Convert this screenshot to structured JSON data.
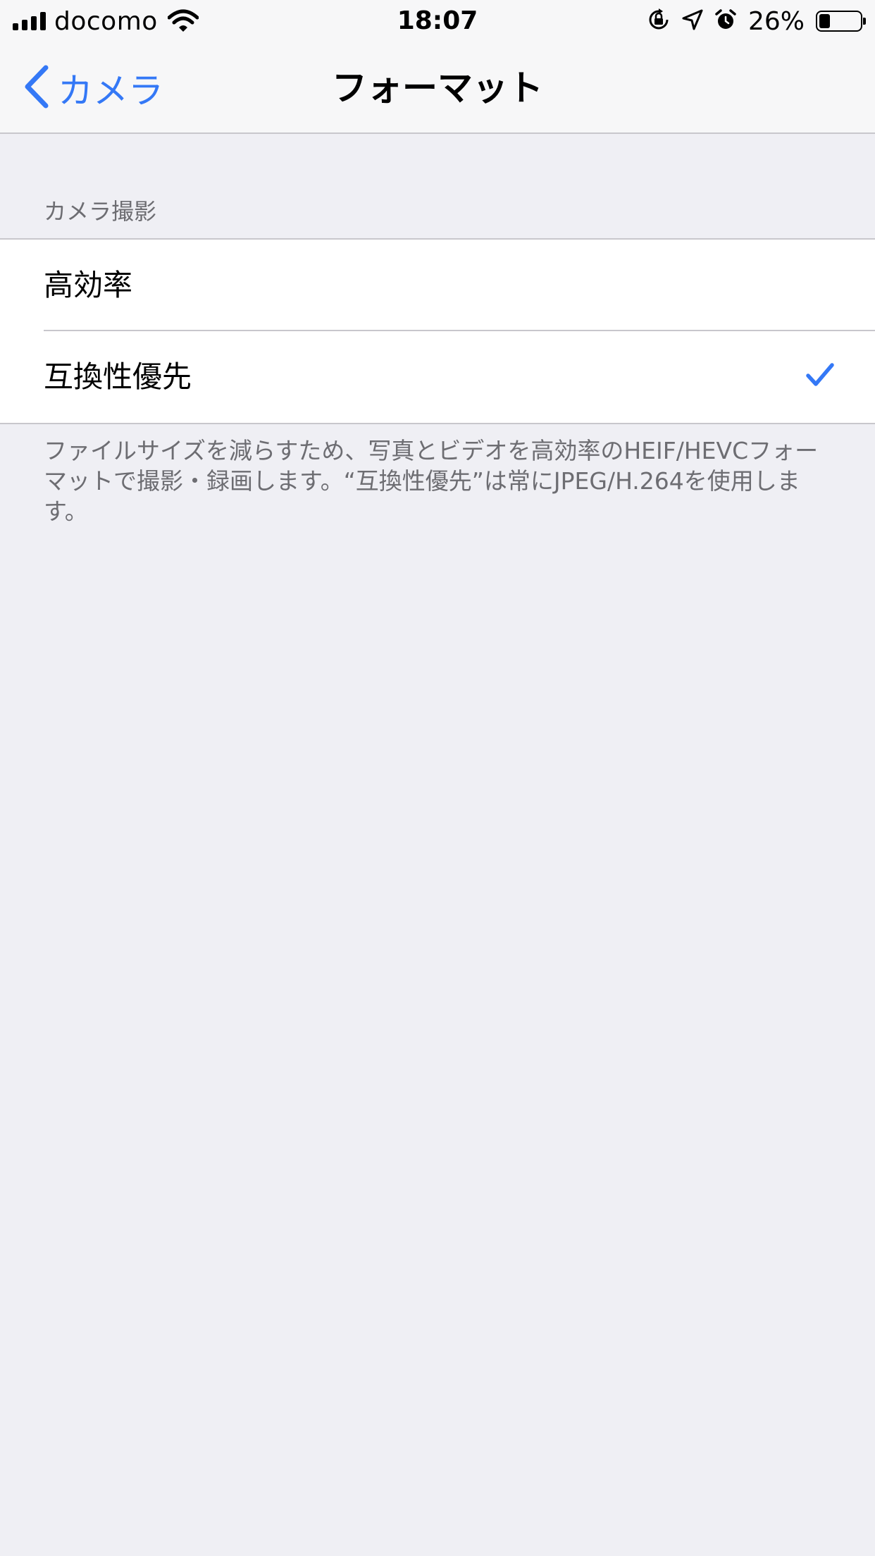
{
  "status_bar": {
    "carrier": "docomo",
    "time": "18:07",
    "battery_percent": "26%",
    "battery_level": 0.26,
    "icons": [
      "signal-icon",
      "wifi-icon",
      "orientation-lock-icon",
      "location-icon",
      "alarm-icon",
      "battery-icon"
    ]
  },
  "nav": {
    "back_label": "カメラ",
    "title": "フォーマット"
  },
  "section": {
    "header": "カメラ撮影",
    "options": [
      {
        "label": "高効率",
        "selected": false
      },
      {
        "label": "互換性優先",
        "selected": true
      }
    ],
    "footer": "ファイルサイズを減らすため、写真とビデオを高効率のHEIF/HEVCフォーマットで撮影・録画します。“互換性優先”は常にJPEG/H.264を使用します。"
  },
  "colors": {
    "accent": "#3478f6",
    "background": "#efeff4",
    "secondary_text": "#6d6d72",
    "separator": "#c8c7cc"
  }
}
